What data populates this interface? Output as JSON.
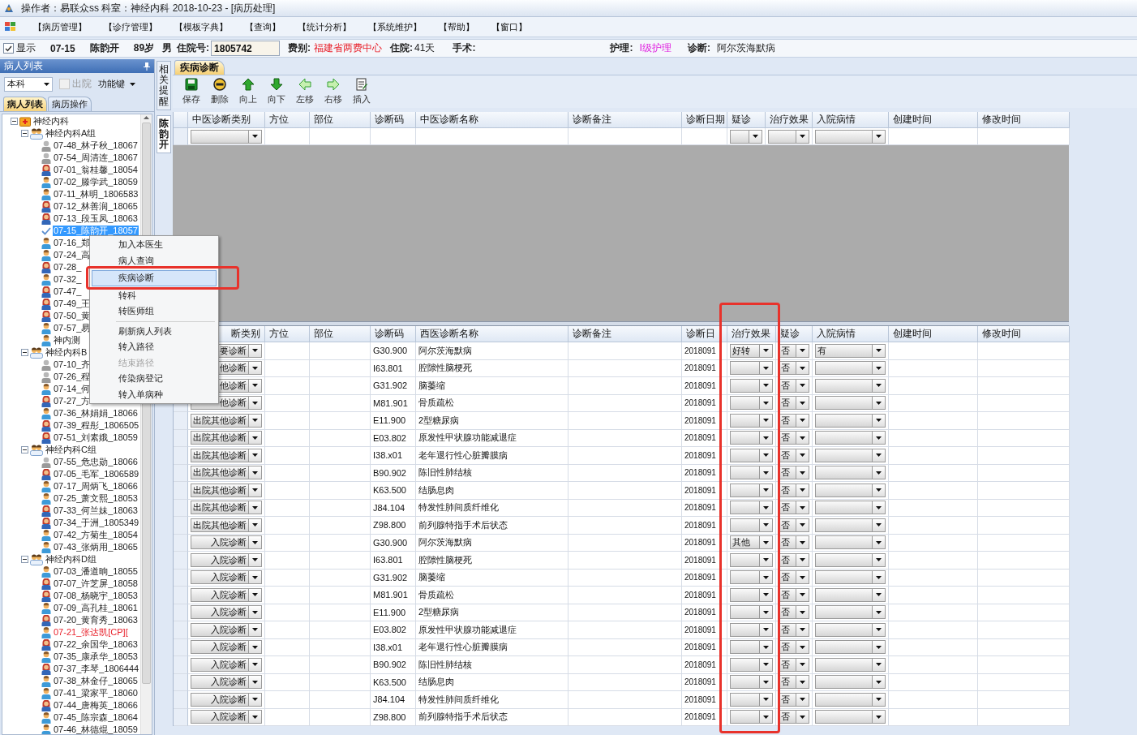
{
  "window": {
    "title": "操作者：易联众ss  科室：神经内科  2018-10-23 - [病历处理]"
  },
  "menu": [
    "【病历管理】",
    "【诊疗管理】",
    "【模板字典】",
    "【查询】",
    "【统计分析】",
    "【系统维护】",
    "【帮助】",
    "【窗口】"
  ],
  "patient_bar": {
    "show": {
      "label": "显示",
      "checked": true
    },
    "bed": "07-15",
    "name": "陈韵开",
    "age": "89岁",
    "sex": "男",
    "admission_no": {
      "label": "住院号:",
      "value": "1805742"
    },
    "fee": {
      "label": "费别:",
      "value": "福建省两费中心"
    },
    "stay": {
      "label": "住院:",
      "value": "41天"
    },
    "surgery": {
      "label": "手术:"
    },
    "nursing": {
      "label": "护理:",
      "value": "Ⅰ级护理"
    },
    "diagnosis": {
      "label": "诊断:",
      "value": "阿尔茨海默病"
    }
  },
  "patient_list": {
    "title": "病人列表",
    "scope": "本科",
    "discharged": {
      "label": "出院",
      "checked": false,
      "disabled": true
    },
    "function_key": "功能键",
    "tabs": [
      {
        "label": "病人列表",
        "selected": true
      },
      {
        "label": "病历操作",
        "selected": false
      }
    ],
    "tree": [
      {
        "label": "神经内科",
        "kind": "department",
        "expanded": true,
        "children": [
          {
            "label": "神经内科A组",
            "kind": "group",
            "expanded": true,
            "children": [
              {
                "label": "07-48_林子秋_18067",
                "kind": "inactive",
                "selected": false,
                "flagged": false
              },
              {
                "label": "07-54_周清连_18067",
                "kind": "inactive",
                "selected": false,
                "flagged": false
              },
              {
                "label": "07-01_翁桂馨_18054",
                "kind": "female",
                "selected": false,
                "flagged": false
              },
              {
                "label": "07-02_滕学武_18059",
                "kind": "male",
                "selected": false,
                "flagged": false
              },
              {
                "label": "07-11_林明_1806583",
                "kind": "male",
                "selected": false,
                "flagged": false
              },
              {
                "label": "07-12_林善润_18065",
                "kind": "female",
                "selected": false,
                "flagged": false
              },
              {
                "label": "07-13_段玉凤_18063",
                "kind": "female",
                "selected": false,
                "flagged": false
              },
              {
                "label": "07-15_陈韵开_18057",
                "kind": "checked",
                "selected": true,
                "flagged": false
              },
              {
                "label": "07-16_郑",
                "kind": "male",
                "selected": false,
                "flagged": false
              },
              {
                "label": "07-24_高",
                "kind": "male",
                "selected": false,
                "flagged": false
              },
              {
                "label": "07-28_",
                "kind": "female",
                "selected": false,
                "flagged": false
              },
              {
                "label": "07-32_",
                "kind": "male",
                "selected": false,
                "flagged": false
              },
              {
                "label": "07-47_",
                "kind": "female",
                "selected": false,
                "flagged": false
              },
              {
                "label": "07-49_王",
                "kind": "female",
                "selected": false,
                "flagged": false
              },
              {
                "label": "07-50_黄",
                "kind": "female",
                "selected": false,
                "flagged": false
              },
              {
                "label": "07-57_易",
                "kind": "male",
                "selected": false,
                "flagged": false
              },
              {
                "label": "神内测",
                "kind": "male",
                "selected": false,
                "flagged": false
              }
            ]
          },
          {
            "label": "神经内科B",
            "kind": "group",
            "expanded": true,
            "children": [
              {
                "label": "07-10_齐",
                "kind": "inactive",
                "selected": false,
                "flagged": false
              },
              {
                "label": "07-26_程",
                "kind": "inactive",
                "selected": false,
                "flagged": false
              },
              {
                "label": "07-14_何",
                "kind": "male",
                "selected": false,
                "flagged": false
              },
              {
                "label": "07-27_方",
                "kind": "female",
                "selected": false,
                "flagged": false
              },
              {
                "label": "07-36_林娟娟_18066",
                "kind": "male",
                "selected": false,
                "flagged": false
              },
              {
                "label": "07-39_程彤_1806505",
                "kind": "female",
                "selected": false,
                "flagged": false
              },
              {
                "label": "07-51_刘素娥_18059",
                "kind": "female",
                "selected": false,
                "flagged": false
              }
            ]
          },
          {
            "label": "神经内科C组",
            "kind": "group",
            "expanded": true,
            "children": [
              {
                "label": "07-55_危忠勋_18066",
                "kind": "inactive",
                "selected": false,
                "flagged": false
              },
              {
                "label": "07-05_毛军_1806589",
                "kind": "female",
                "selected": false,
                "flagged": false
              },
              {
                "label": "07-17_周炳飞_18066",
                "kind": "male",
                "selected": false,
                "flagged": false
              },
              {
                "label": "07-25_萧文熙_18053",
                "kind": "male",
                "selected": false,
                "flagged": false
              },
              {
                "label": "07-33_何兰妹_18063",
                "kind": "female",
                "selected": false,
                "flagged": false
              },
              {
                "label": "07-34_于洲_1805349",
                "kind": "female",
                "selected": false,
                "flagged": false
              },
              {
                "label": "07-42_方菊生_18054",
                "kind": "male",
                "selected": false,
                "flagged": false
              },
              {
                "label": "07-43_张炳用_18065",
                "kind": "male",
                "selected": false,
                "flagged": false
              }
            ]
          },
          {
            "label": "神经内科D组",
            "kind": "group",
            "expanded": true,
            "children": [
              {
                "label": "07-03_潘道晌_18055",
                "kind": "male",
                "selected": false,
                "flagged": false
              },
              {
                "label": "07-07_许芝屏_18058",
                "kind": "female",
                "selected": false,
                "flagged": false
              },
              {
                "label": "07-08_杨晓宇_18053",
                "kind": "female",
                "selected": false,
                "flagged": false
              },
              {
                "label": "07-09_高孔桂_18061",
                "kind": "male",
                "selected": false,
                "flagged": false
              },
              {
                "label": "07-20_黄育秀_18063",
                "kind": "female",
                "selected": false,
                "flagged": false
              },
              {
                "label": "07-21_张达凯[CP][",
                "kind": "male",
                "selected": false,
                "flagged": true
              },
              {
                "label": "07-22_余国华_18063",
                "kind": "female",
                "selected": false,
                "flagged": false
              },
              {
                "label": "07-35_康承华_18053",
                "kind": "male",
                "selected": false,
                "flagged": false
              },
              {
                "label": "07-37_李琴_1806444",
                "kind": "female",
                "selected": false,
                "flagged": false
              },
              {
                "label": "07-38_林金仔_18065",
                "kind": "male",
                "selected": false,
                "flagged": false
              },
              {
                "label": "07-41_梁家平_18060",
                "kind": "male",
                "selected": false,
                "flagged": false
              },
              {
                "label": "07-44_唐梅英_18066",
                "kind": "female",
                "selected": false,
                "flagged": false
              },
              {
                "label": "07-45_陈宗森_18064",
                "kind": "male",
                "selected": false,
                "flagged": false
              },
              {
                "label": "07-46_林德焜_18059",
                "kind": "male",
                "selected": false,
                "flagged": false
              }
            ]
          }
        ]
      }
    ]
  },
  "side_tabs": [
    {
      "label": "相关提醒",
      "selected": false
    },
    {
      "label": "陈韵开",
      "selected": true
    }
  ],
  "main_tabs": [
    {
      "label": "疾病诊断",
      "selected": true
    }
  ],
  "toolbar": [
    {
      "label": "保存",
      "kind": "save"
    },
    {
      "label": "删除",
      "kind": "delete"
    },
    {
      "label": "向上",
      "kind": "up"
    },
    {
      "label": "向下",
      "kind": "down"
    },
    {
      "label": "左移",
      "kind": "left"
    },
    {
      "label": "右移",
      "kind": "right"
    },
    {
      "label": "插入",
      "kind": "insert"
    }
  ],
  "tcm_grid": {
    "columns": [
      "中医诊断类别",
      "方位",
      "部位",
      "诊断码",
      "中医诊断名称",
      "诊断备注",
      "诊断日期",
      "疑诊",
      "治疗效果",
      "入院病情",
      "创建时间",
      "修改时间"
    ]
  },
  "western_grid": {
    "columns": [
      "断类别",
      "方位",
      "部位",
      "诊断码",
      "西医诊断名称",
      "诊断备注",
      "诊断日",
      "治疗效果",
      "疑诊",
      "入院病情",
      "创建时间",
      "修改时间"
    ],
    "rows": [
      {
        "type": "要诊断",
        "code": "G30.900",
        "name": "阿尔茨海默病",
        "date": "2018091",
        "effect": "好转",
        "suspect": "否",
        "admission": "有"
      },
      {
        "type": "他诊断",
        "code": "I63.801",
        "name": "腔隙性脑梗死",
        "date": "2018091",
        "suspect": "否"
      },
      {
        "type": "他诊断",
        "code": "G31.902",
        "name": "脑萎缩",
        "date": "2018091",
        "suspect": "否"
      },
      {
        "type": "他诊断",
        "code": "M81.901",
        "name": "骨质疏松",
        "date": "2018091",
        "suspect": "否"
      },
      {
        "type": "出院其他诊断",
        "code": "E11.900",
        "name": "2型糖尿病",
        "date": "2018091",
        "suspect": "否"
      },
      {
        "type": "出院其他诊断",
        "code": "E03.802",
        "name": "原发性甲状腺功能减退症",
        "date": "2018091",
        "suspect": "否"
      },
      {
        "type": "出院其他诊断",
        "code": "I38.x01",
        "name": "老年退行性心脏瓣膜病",
        "date": "2018091",
        "suspect": "否"
      },
      {
        "type": "出院其他诊断",
        "code": "B90.902",
        "name": "陈旧性肺结核",
        "date": "2018091",
        "suspect": "否"
      },
      {
        "type": "出院其他诊断",
        "code": "K63.500",
        "name": "结肠息肉",
        "date": "2018091",
        "suspect": "否"
      },
      {
        "type": "出院其他诊断",
        "code": "J84.104",
        "name": "特发性肺间质纤维化",
        "date": "2018091",
        "suspect": "否"
      },
      {
        "type": "出院其他诊断",
        "code": "Z98.800",
        "name": "前列腺特指手术后状态",
        "date": "2018091",
        "suspect": "否"
      },
      {
        "type": "入院诊断",
        "code": "G30.900",
        "name": "阿尔茨海默病",
        "date": "2018091",
        "effect": "其他",
        "suspect": "否"
      },
      {
        "type": "入院诊断",
        "code": "I63.801",
        "name": "腔隙性脑梗死",
        "date": "2018091",
        "suspect": "否"
      },
      {
        "type": "入院诊断",
        "code": "G31.902",
        "name": "脑萎缩",
        "date": "2018091",
        "suspect": "否"
      },
      {
        "type": "入院诊断",
        "code": "M81.901",
        "name": "骨质疏松",
        "date": "2018091",
        "suspect": "否"
      },
      {
        "type": "入院诊断",
        "code": "E11.900",
        "name": "2型糖尿病",
        "date": "2018091",
        "suspect": "否"
      },
      {
        "type": "入院诊断",
        "code": "E03.802",
        "name": "原发性甲状腺功能减退症",
        "date": "2018091",
        "suspect": "否"
      },
      {
        "type": "入院诊断",
        "code": "I38.x01",
        "name": "老年退行性心脏瓣膜病",
        "date": "2018091",
        "suspect": "否"
      },
      {
        "type": "入院诊断",
        "code": "B90.902",
        "name": "陈旧性肺结核",
        "date": "2018091",
        "suspect": "否"
      },
      {
        "type": "入院诊断",
        "code": "K63.500",
        "name": "结肠息肉",
        "date": "2018091",
        "suspect": "否"
      },
      {
        "type": "入院诊断",
        "code": "J84.104",
        "name": "特发性肺间质纤维化",
        "date": "2018091",
        "suspect": "否"
      },
      {
        "type": "入院诊断",
        "code": "Z98.800",
        "name": "前列腺特指手术后状态",
        "date": "2018091",
        "suspect": "否"
      }
    ]
  },
  "context_menu": [
    {
      "kind": "item",
      "label": "加入本医生",
      "selected": false,
      "disabled": false
    },
    {
      "kind": "item",
      "label": "病人查询",
      "selected": false,
      "disabled": false
    },
    {
      "kind": "item",
      "label": "疾病诊断",
      "selected": true,
      "disabled": false
    },
    {
      "kind": "item",
      "label": "转科",
      "selected": false,
      "disabled": false
    },
    {
      "kind": "item",
      "label": "转医师组",
      "selected": false,
      "disabled": false
    },
    {
      "kind": "separator"
    },
    {
      "kind": "item",
      "label": "刷新病人列表",
      "selected": false,
      "disabled": false
    },
    {
      "kind": "item",
      "label": "转入路径",
      "selected": false,
      "disabled": false
    },
    {
      "kind": "item",
      "label": "结束路径",
      "selected": false,
      "disabled": true
    },
    {
      "kind": "item",
      "label": "传染病登记",
      "selected": false,
      "disabled": false
    },
    {
      "kind": "item",
      "label": "转入单病种",
      "selected": false,
      "disabled": false
    }
  ]
}
